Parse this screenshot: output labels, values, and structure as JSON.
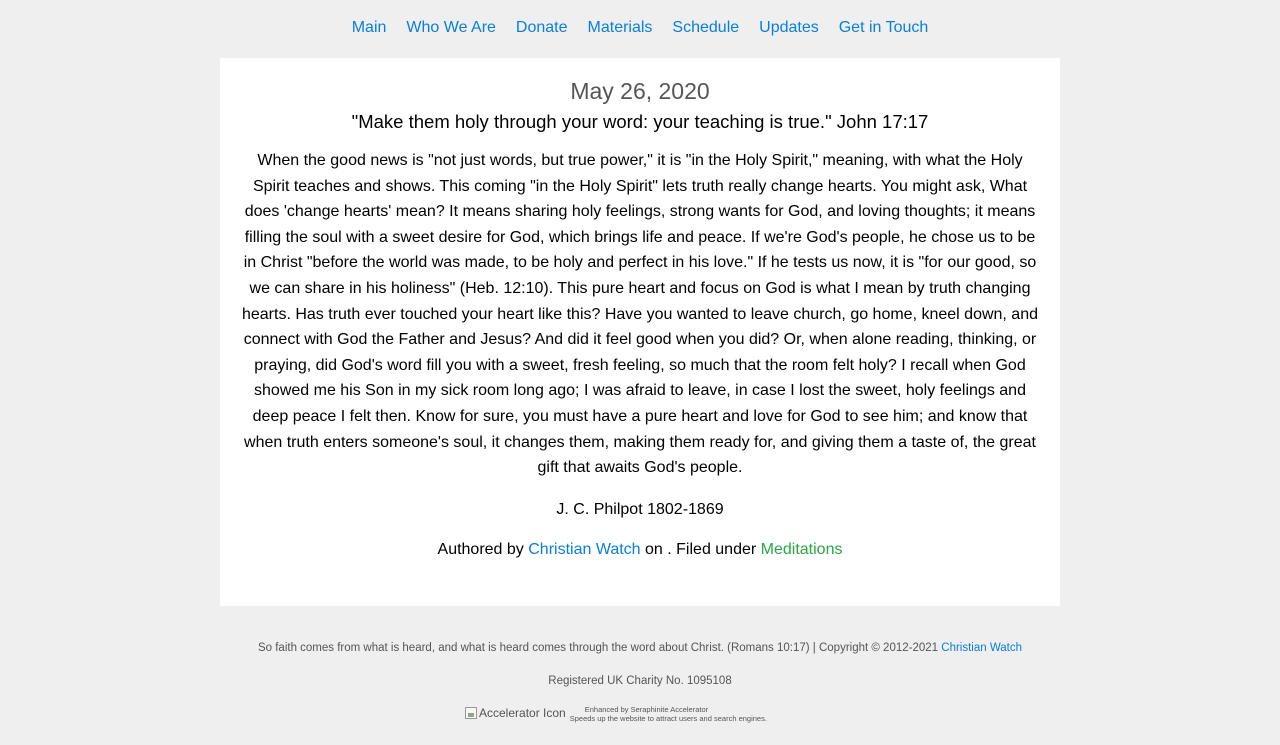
{
  "nav": {
    "items": [
      "Main",
      "Who We Are",
      "Donate",
      "Materials",
      "Schedule",
      "Updates",
      "Get in Touch"
    ]
  },
  "post": {
    "date": "May 26, 2020",
    "verse": "\"Make them holy through your word: your teaching is true.\" John 17:17",
    "body": "When the good news is \"not just words, but true power,\" it is \"in the Holy Spirit,\" meaning, with what the Holy Spirit teaches and shows. This coming \"in the Holy Spirit\" lets truth really change hearts. You might ask, What does 'change hearts' mean? It means sharing holy feelings, strong wants for God, and loving thoughts; it means filling the soul with a sweet desire for God, which brings life and peace. If we're God's people, he chose us to be in Christ \"before the world was made, to be holy and perfect in his love.\" If he tests us now, it is \"for our good, so we can share in his holiness\" (Heb. 12:10). This pure heart and focus on God is what I mean by truth changing hearts. Has truth ever touched your heart like this? Have you wanted to leave church, go home, kneel down, and connect with God the Father and Jesus? And did it feel good when you did? Or, when alone reading, thinking, or praying, did God's word fill you with a sweet, fresh feeling, so much that the room felt holy? I recall when God showed me his Son in my sick room long ago; I was afraid to leave, in case I lost the sweet, holy feelings and deep peace I felt then. Know for sure, you must have a pure heart and love for God to see him; and know that when truth enters someone's soul, it changes them, making them ready for, and giving them a taste of, the great gift that awaits God's people.",
    "author_credit": "J. C. Philpot 1802-1869",
    "meta": {
      "prefix": "Authored by ",
      "author_link": "Christian Watch",
      "middle": " on . Filed under ",
      "category_link": "Meditations"
    }
  },
  "footer": {
    "line1_text": "So faith comes from what is heard, and what is heard comes through the word about Christ. (Romans 10:17) | Copyright © 2012-2021 ",
    "line1_link": "Christian Watch",
    "line2": "Registered UK Charity No. 1095108",
    "accelerator": {
      "img_alt": "Accelerator Icon",
      "line1": "Enhanced by Seraphinite Accelerator",
      "line2": "Speeds up the website to attract users and search engines."
    }
  },
  "colors": {
    "link_blue": "#0a7fe0",
    "link_green": "#28a745",
    "background": "#efefef",
    "card": "#ffffff"
  }
}
